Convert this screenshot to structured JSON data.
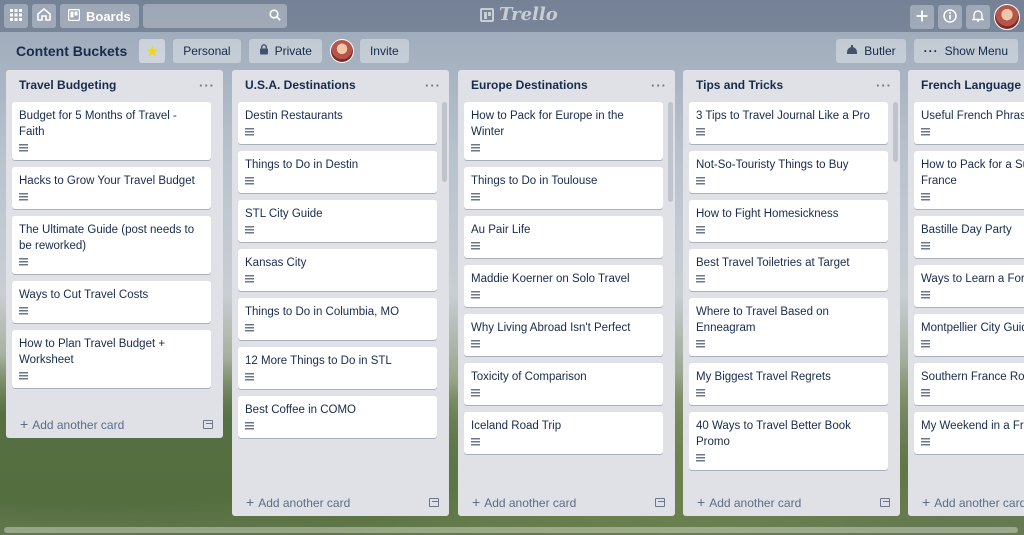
{
  "header": {
    "boards_label": "Boards",
    "search_placeholder": "",
    "logo_text": "Trello"
  },
  "board": {
    "title": "Content Buckets",
    "visibility_team": "Personal",
    "visibility_privacy": "Private",
    "invite_label": "Invite",
    "butler_label": "Butler",
    "show_menu_label": "Show Menu"
  },
  "lists": [
    {
      "title": "Travel Budgeting",
      "cards": [
        "Budget for 5 Months of Travel - Faith",
        "Hacks to Grow Your Travel Budget",
        "The Ultimate Guide (post needs to be reworked)",
        "Ways to Cut Travel Costs",
        "How to Plan Travel Budget + Worksheet"
      ]
    },
    {
      "title": "U.S.A. Destinations",
      "cards": [
        "Destin Restaurants",
        "Things to Do in Destin",
        "STL City Guide",
        "Kansas City",
        "Things to Do in Columbia, MO",
        "12 More Things to Do in STL",
        "Best Coffee in COMO"
      ]
    },
    {
      "title": "Europe Destinations",
      "cards": [
        "How to Pack for Europe in the Winter",
        "Things to Do in Toulouse",
        "Au Pair Life",
        "Maddie Koerner on Solo Travel",
        "Why Living Abroad Isn't Perfect",
        "Toxicity of Comparison",
        "Iceland Road Trip"
      ]
    },
    {
      "title": "Tips and Tricks",
      "cards": [
        "3 Tips to Travel Journal Like a Pro",
        "Not-So-Touristy Things to Buy",
        "How to Fight Homesickness",
        "Best Travel Toiletries at Target",
        "Where to Travel Based on Enneagram",
        "My Biggest Travel Regrets",
        "40 Ways to Travel Better Book Promo"
      ]
    },
    {
      "title": "French Language L",
      "cards": [
        "Useful French Phras",
        "How to Pack for a Su France",
        "Bastille Day Party",
        "Ways to Learn a Fore",
        "Montpellier City Guid",
        "Southern France Roa",
        "My Weekend in a Fre"
      ]
    }
  ],
  "add_card_label": "Add another card"
}
